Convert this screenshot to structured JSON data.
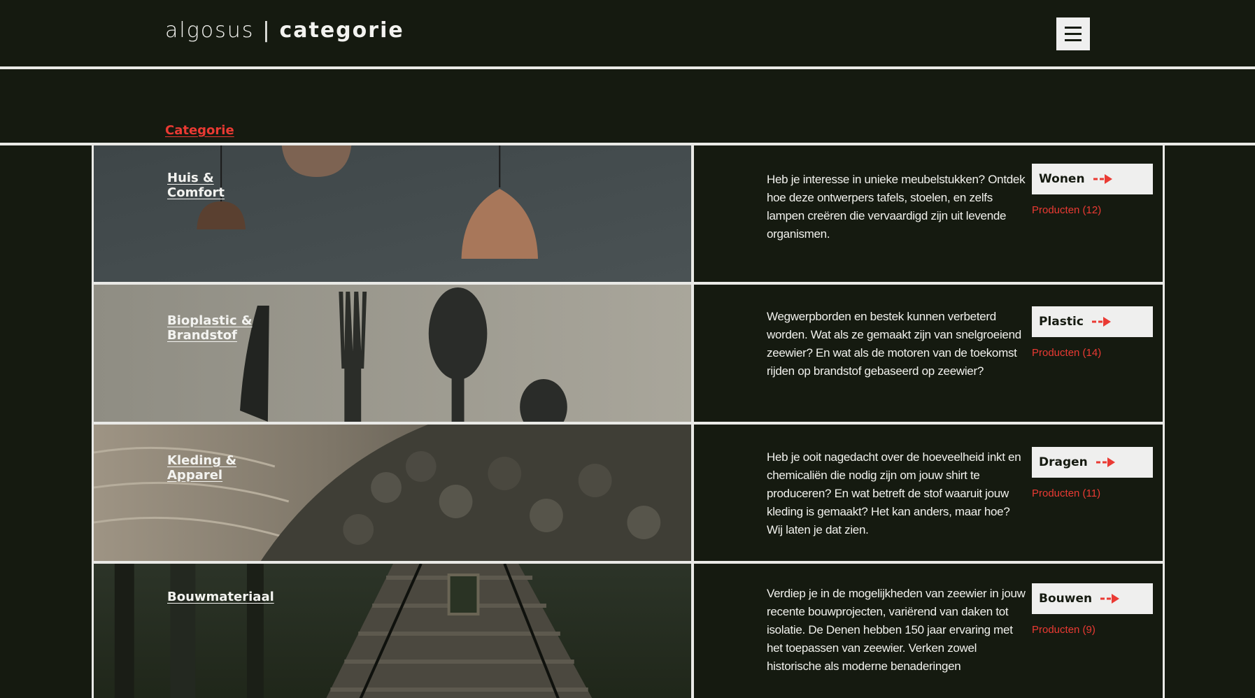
{
  "header": {
    "brand_light": "algosus",
    "brand_sep": "|",
    "brand_bold": "categorie",
    "menu_icon": "hamburger-menu-icon"
  },
  "section": {
    "link": "Categorie"
  },
  "colors": {
    "background": "#151a10",
    "border": "#e9e9e6",
    "accent": "#ea3a33",
    "button_bg": "#efefee"
  },
  "categories": [
    {
      "title": "Huis &\nComfort",
      "image": "pendant-lamps-photo",
      "description": "Heb je interesse in unieke meubelstukken? Ontdek hoe deze ontwerpers tafels, stoelen, en zelfs lampen creëren die vervaardigd zijn uit levende organismen.",
      "button": "Wonen",
      "count": "Producten (12)"
    },
    {
      "title": "Bioplastic &\nBrandstof",
      "image": "cutlery-photo",
      "description": "Wegwerpborden en bestek kunnen verbeterd worden. Wat als ze gemaakt zijn van snelgroeiend zeewier? En wat als de motoren van de toekomst rijden op brandstof gebaseerd op zeewier?",
      "button": "Plastic",
      "count": "Producten (14)"
    },
    {
      "title": "Kleding &\nApparel",
      "image": "textile-scales-photo",
      "description": "Heb je ooit nagedacht over de hoeveelheid inkt en chemicaliën die nodig zijn om jouw shirt te produceren? En wat betreft de stof waaruit jouw kleding is gemaakt? Het kan anders, maar hoe? Wij laten je dat zien.",
      "button": "Dragen",
      "count": "Producten (11)"
    },
    {
      "title": "Bouwmateriaal",
      "image": "seaweed-house-photo",
      "description": "Verdiep je in de mogelijkheden van zeewier in jouw recente bouwprojecten, variërend van daken tot isolatie. De Denen hebben 150 jaar ervaring met het toepassen van zeewier. Verken zowel historische als moderne benaderingen",
      "button": "Bouwen",
      "count": "Producten (9)"
    }
  ]
}
